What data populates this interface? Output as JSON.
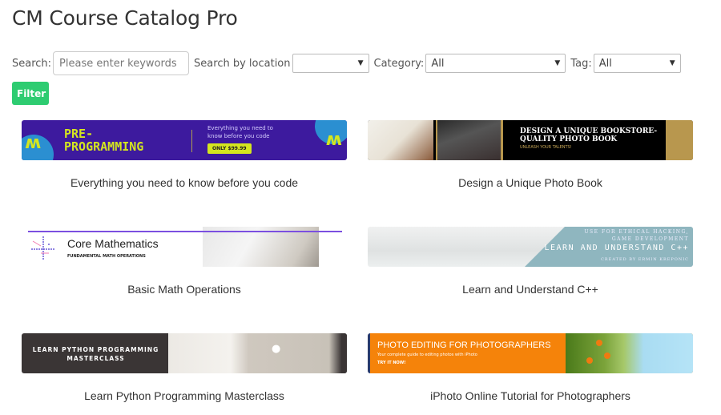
{
  "page": {
    "title": "CM Course Catalog Pro"
  },
  "filters": {
    "search_label": "Search:",
    "search_placeholder": "Please enter keywords",
    "search_value": "",
    "location_label": "Search by location",
    "location_value": "",
    "category_label": "Category:",
    "category_value": "All",
    "tag_label": "Tag:",
    "tag_value": "All",
    "filter_button": "Filter"
  },
  "courses": [
    {
      "title": "Everything you need to know before you code",
      "banner": {
        "headline": "PRE-\nPROGRAMMING",
        "subtitle": "Everything you need to know before you code",
        "price_badge": "ONLY $99.99",
        "colors": {
          "bg": "#3d1a9e",
          "accent": "#d4e61f"
        }
      }
    },
    {
      "title": "Design a Unique Photo Book",
      "banner": {
        "headline": "DESIGN A UNIQUE BOOKSTORE-QUALITY PHOTO BOOK",
        "subtitle": "UNLEASH YOUR TALENTS!",
        "colors": {
          "bg": "#000000",
          "accent": "#b8974e"
        }
      }
    },
    {
      "title": "Basic Math Operations",
      "banner": {
        "headline": "Core Mathematics",
        "subtitle": "FUNDAMENTAL MATH OPERATIONS",
        "colors": {
          "bg": "#ffffff",
          "accent": "#7b4fe0"
        }
      }
    },
    {
      "title": "Learn and Understand C++",
      "banner": {
        "tagline": "USE FOR ETHICAL HACKING, GAME DEVELOPMENT",
        "headline": "LEARN AND UNDERSTAND C++",
        "subtitle": "CREATED BY ERMIN KREPONIC",
        "colors": {
          "accent": "#8fb6bf"
        }
      }
    },
    {
      "title": "Learn Python Programming Masterclass",
      "banner": {
        "headline": "LEARN PYTHON PROGRAMMING MASTERCLASS",
        "colors": {
          "bg": "#3a3535"
        }
      }
    },
    {
      "title": "iPhoto Online Tutorial for Photographers",
      "banner": {
        "headline": "PHOTO EDITING FOR PHOTOGRAPHERS",
        "subtitle": "Your complete guide to editing photos with iPhoto",
        "cta": "TRY IT NOW!",
        "colors": {
          "bg": "#f5830a"
        }
      }
    }
  ],
  "colors": {
    "filter_button": "#2ecc71"
  }
}
